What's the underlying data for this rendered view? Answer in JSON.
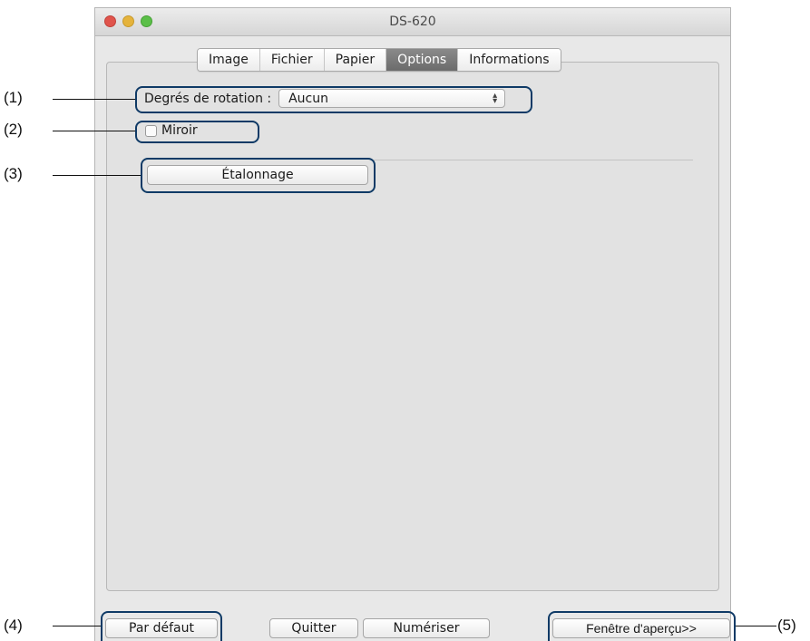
{
  "window": {
    "title": "DS-620"
  },
  "tabs": [
    {
      "label": "Image",
      "active": false
    },
    {
      "label": "Fichier",
      "active": false
    },
    {
      "label": "Papier",
      "active": false
    },
    {
      "label": "Options",
      "active": true
    },
    {
      "label": "Informations",
      "active": false
    }
  ],
  "options": {
    "rotation_label": "Degrés de rotation :",
    "rotation_value": "Aucun",
    "mirror_label": "Miroir",
    "mirror_checked": false,
    "calibration_button": "Étalonnage"
  },
  "footer": {
    "default_button": "Par défaut",
    "quit_button": "Quitter",
    "scan_button": "Numériser",
    "preview_button": "Fenêtre d'aperçu>>"
  },
  "callouts": {
    "c1": "(1)",
    "c2": "(2)",
    "c3": "(3)",
    "c4": "(4)",
    "c5": "(5)"
  },
  "colors": {
    "callout_border": "#0f3a66",
    "active_tab": "#7a7a7a"
  }
}
